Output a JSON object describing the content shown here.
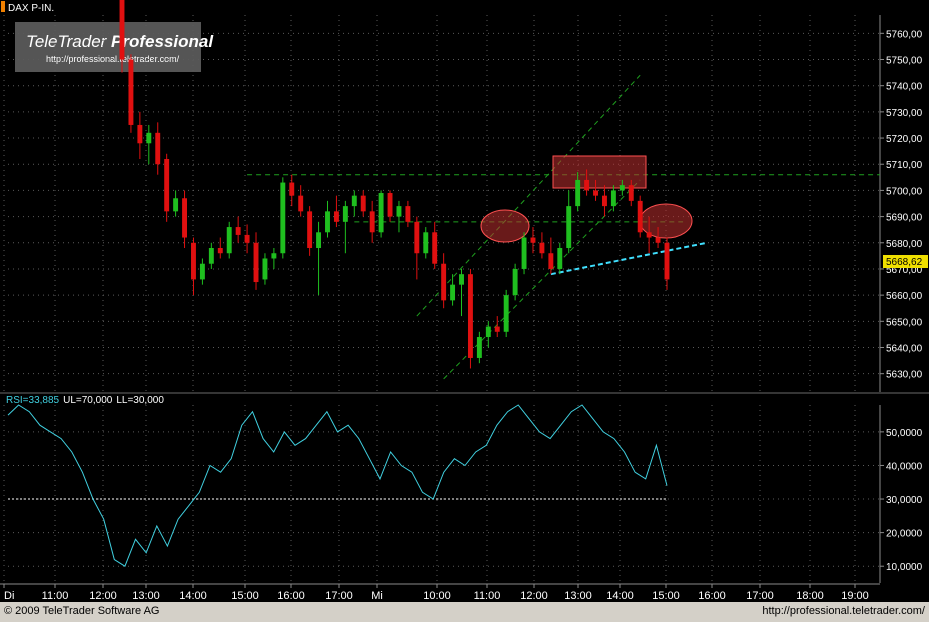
{
  "header": {
    "symbol": "DAX P-IN."
  },
  "watermark": {
    "brand_a": "TeleTrader ",
    "brand_b": "Professional",
    "url": "http://professional.teletrader.com/"
  },
  "footer": {
    "copyright": "© 2009 TeleTrader Software AG",
    "url": "http://professional.teletrader.com/"
  },
  "colors": {
    "up": "#1fbf1f",
    "down": "#e01010",
    "trend": "#1f9f1f",
    "support": "#40e0ff",
    "rsi": "#40d0e0",
    "highlight": "#c03030",
    "current_price_bg": "#f0e000"
  },
  "chart_data": [
    {
      "type": "candlestick",
      "title": "DAX P-IN.",
      "current_price": "5668,62",
      "y_ticks": [
        "5760,00",
        "5750,00",
        "5740,00",
        "5730,00",
        "5720,00",
        "5710,00",
        "5700,00",
        "5690,00",
        "5680,00",
        "5670,00",
        "5660,00",
        "5650,00",
        "5640,00",
        "5630,00"
      ],
      "ylim": [
        5623,
        5767
      ],
      "x_ticks": [
        "Di",
        "11:00",
        "12:00",
        "13:00",
        "14:00",
        "15:00",
        "16:00",
        "17:00",
        "Mi",
        "10:00",
        "11:00",
        "12:00",
        "13:00",
        "14:00",
        "15:00",
        "16:00",
        "17:00",
        "18:00",
        "19:00"
      ],
      "x_axis_note": "x values are bar indices; ticks map to bar positions",
      "candles": [
        [
          0,
          5790,
          5792,
          5745,
          5750
        ],
        [
          1,
          5750,
          5752,
          5722,
          5725
        ],
        [
          2,
          5725,
          5730,
          5712,
          5718
        ],
        [
          3,
          5718,
          5725,
          5710,
          5722
        ],
        [
          4,
          5722,
          5726,
          5706,
          5710
        ],
        [
          5,
          5712,
          5714,
          5688,
          5692
        ],
        [
          6,
          5692,
          5700,
          5690,
          5697
        ],
        [
          7,
          5697,
          5700,
          5678,
          5682
        ],
        [
          8,
          5680,
          5682,
          5660,
          5666
        ],
        [
          9,
          5666,
          5674,
          5664,
          5672
        ],
        [
          10,
          5672,
          5680,
          5670,
          5678
        ],
        [
          11,
          5678,
          5682,
          5674,
          5676
        ],
        [
          12,
          5676,
          5688,
          5674,
          5686
        ],
        [
          13,
          5686,
          5690,
          5680,
          5683
        ],
        [
          14,
          5683,
          5687,
          5676,
          5680
        ],
        [
          15,
          5680,
          5684,
          5662,
          5665
        ],
        [
          16,
          5666,
          5676,
          5664,
          5674
        ],
        [
          17,
          5674,
          5678,
          5670,
          5676
        ],
        [
          18,
          5676,
          5705,
          5674,
          5703
        ],
        [
          19,
          5703,
          5706,
          5694,
          5698
        ],
        [
          20,
          5698,
          5702,
          5690,
          5692
        ],
        [
          21,
          5692,
          5694,
          5675,
          5678
        ],
        [
          22,
          5678,
          5688,
          5660,
          5684
        ],
        [
          23,
          5684,
          5696,
          5682,
          5692
        ],
        [
          24,
          5692,
          5698,
          5686,
          5688
        ],
        [
          25,
          5688,
          5696,
          5676,
          5694
        ],
        [
          26,
          5694,
          5700,
          5690,
          5698
        ],
        [
          27,
          5698,
          5700,
          5690,
          5692
        ],
        [
          28,
          5692,
          5696,
          5680,
          5684
        ],
        [
          29,
          5684,
          5700,
          5682,
          5699
        ],
        [
          30,
          5699,
          5700,
          5688,
          5690
        ],
        [
          31,
          5690,
          5696,
          5684,
          5694
        ],
        [
          32,
          5694,
          5696,
          5686,
          5688
        ],
        [
          33,
          5688,
          5690,
          5666,
          5676
        ],
        [
          34,
          5676,
          5686,
          5674,
          5684
        ],
        [
          35,
          5684,
          5688,
          5670,
          5672
        ],
        [
          36,
          5672,
          5676,
          5655,
          5658
        ],
        [
          37,
          5658,
          5668,
          5656,
          5664
        ],
        [
          38,
          5664,
          5670,
          5652,
          5668
        ],
        [
          39,
          5668,
          5670,
          5632,
          5636
        ],
        [
          40,
          5636,
          5646,
          5634,
          5644
        ],
        [
          41,
          5644,
          5650,
          5640,
          5648
        ],
        [
          42,
          5648,
          5652,
          5644,
          5646
        ],
        [
          43,
          5646,
          5662,
          5644,
          5660
        ],
        [
          44,
          5660,
          5672,
          5658,
          5670
        ],
        [
          45,
          5670,
          5684,
          5668,
          5682
        ],
        [
          46,
          5682,
          5686,
          5676,
          5680
        ],
        [
          47,
          5680,
          5684,
          5674,
          5676
        ],
        [
          48,
          5676,
          5682,
          5668,
          5670
        ],
        [
          49,
          5670,
          5680,
          5668,
          5678
        ],
        [
          50,
          5678,
          5700,
          5676,
          5694
        ],
        [
          51,
          5694,
          5707,
          5692,
          5704
        ],
        [
          52,
          5704,
          5708,
          5698,
          5700
        ],
        [
          53,
          5700,
          5704,
          5696,
          5698
        ],
        [
          54,
          5698,
          5702,
          5690,
          5694
        ],
        [
          55,
          5694,
          5702,
          5692,
          5700
        ],
        [
          56,
          5700,
          5704,
          5698,
          5702
        ],
        [
          57,
          5702,
          5704,
          5694,
          5696
        ],
        [
          58,
          5696,
          5698,
          5682,
          5684
        ],
        [
          59,
          5684,
          5690,
          5676,
          5682
        ],
        [
          60,
          5682,
          5686,
          5678,
          5680
        ],
        [
          61,
          5680,
          5682,
          5662,
          5666
        ]
      ],
      "trend_lines": [
        {
          "name": "horizontal resistance",
          "x": [
            14,
            60
          ],
          "y": [
            5706,
            5706
          ]
        },
        {
          "name": "neckline",
          "x": [
            26,
            60
          ],
          "y": [
            5688,
            5688
          ]
        },
        {
          "name": "channel upper",
          "x": [
            33,
            58
          ],
          "y": [
            5652,
            5744
          ]
        },
        {
          "name": "channel lower",
          "x": [
            36,
            58
          ],
          "y": [
            5628,
            5704
          ]
        },
        {
          "name": "support",
          "x": [
            48,
            61
          ],
          "y": [
            5668,
            5680
          ]
        }
      ]
    },
    {
      "type": "line",
      "title": "RSI=33,885 UL=70,000 LL=30,000",
      "label_main": "RSI=33,885",
      "label_ul": "UL=70,000",
      "label_ll": "LL=30,000",
      "y_ticks": [
        "50,0000",
        "40,0000",
        "30,0000",
        "20,0000",
        "10,0000"
      ],
      "ylim": [
        5,
        58
      ],
      "lower_level": 30,
      "values": [
        55,
        58,
        56,
        52,
        50,
        48,
        44,
        38,
        30,
        24,
        12,
        10,
        18,
        14,
        22,
        16,
        24,
        28,
        32,
        40,
        38,
        42,
        52,
        56,
        48,
        44,
        50,
        46,
        48,
        52,
        56,
        50,
        52,
        48,
        42,
        36,
        44,
        40,
        38,
        32,
        30,
        38,
        42,
        40,
        44,
        46,
        52,
        56,
        58,
        54,
        50,
        48,
        52,
        56,
        58,
        54,
        50,
        48,
        44,
        38,
        36,
        46,
        34
      ]
    }
  ]
}
